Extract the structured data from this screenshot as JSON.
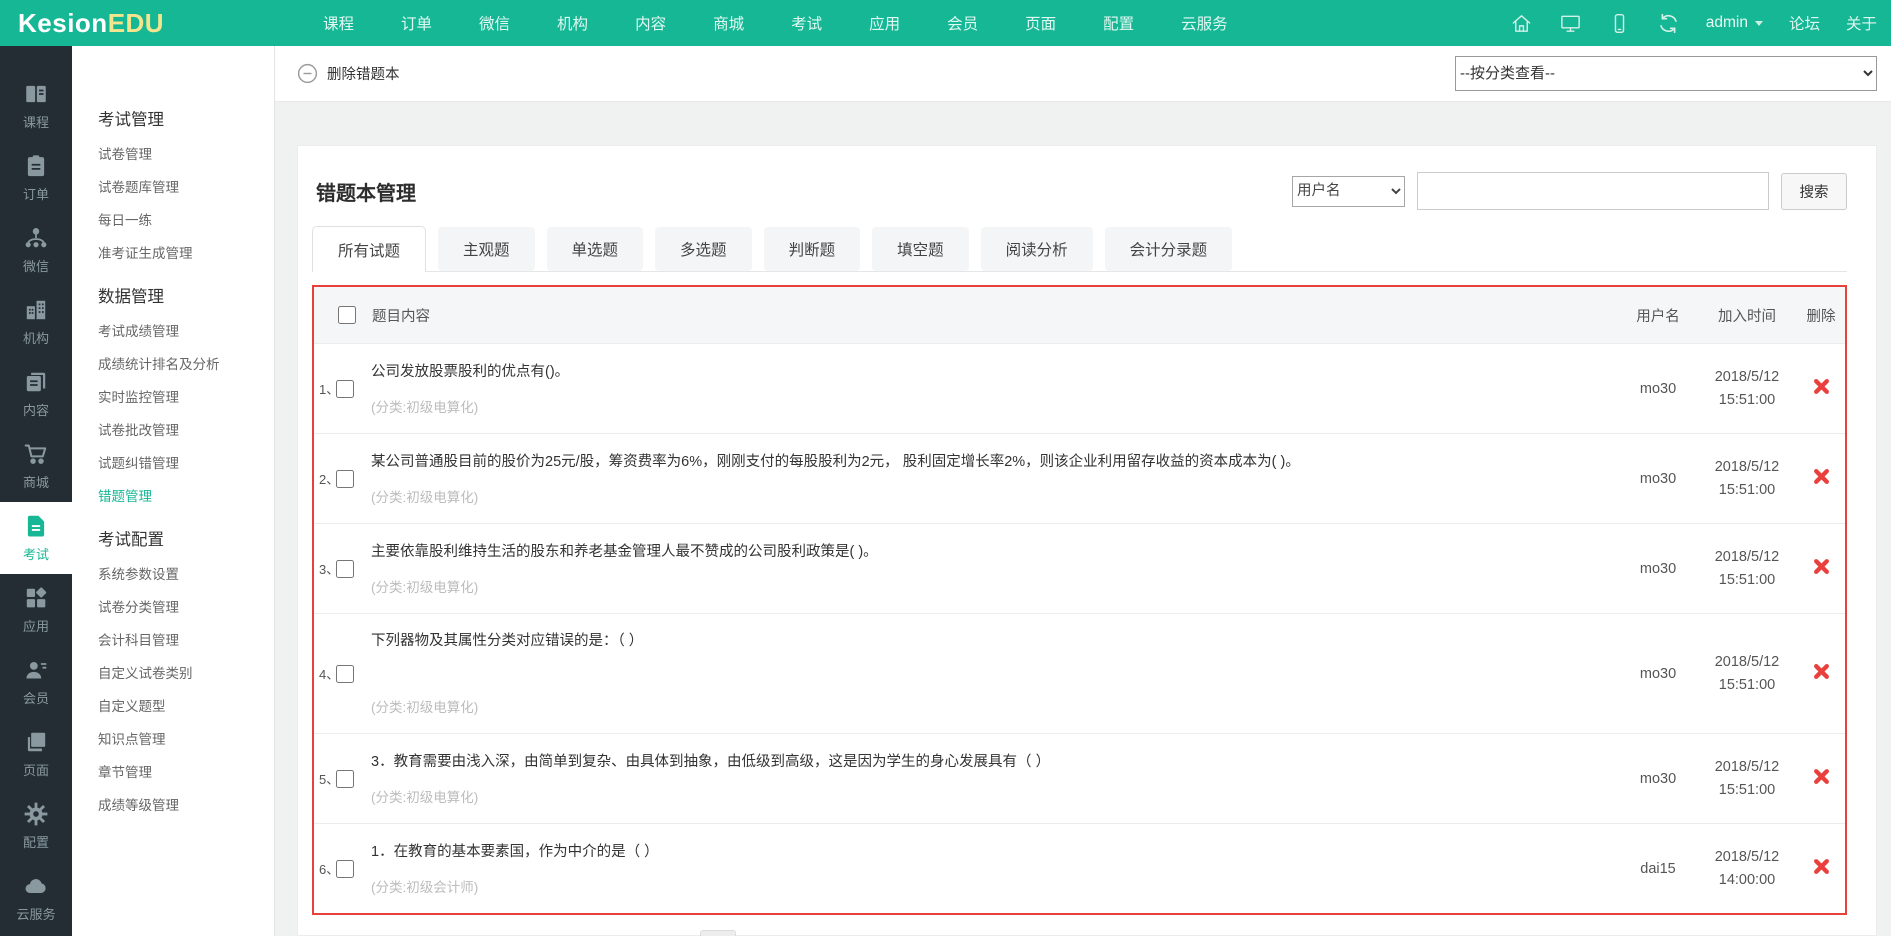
{
  "brand": {
    "name_a": "Kesion",
    "name_b": "EDU"
  },
  "topnav": {
    "items": [
      "课程",
      "订单",
      "微信",
      "机构",
      "内容",
      "商城",
      "考试",
      "应用",
      "会员",
      "页面",
      "配置",
      "云服务"
    ],
    "user": "admin",
    "forum_label": "论坛",
    "about_label": "关于"
  },
  "sidebar": {
    "items": [
      {
        "label": "课程",
        "icon": "courses-icon"
      },
      {
        "label": "订单",
        "icon": "orders-icon"
      },
      {
        "label": "微信",
        "icon": "wechat-icon"
      },
      {
        "label": "机构",
        "icon": "org-icon"
      },
      {
        "label": "内容",
        "icon": "content-icon"
      },
      {
        "label": "商城",
        "icon": "mall-icon"
      },
      {
        "label": "考试",
        "icon": "exam-icon",
        "active": true
      },
      {
        "label": "应用",
        "icon": "apps-icon"
      },
      {
        "label": "会员",
        "icon": "member-icon"
      },
      {
        "label": "页面",
        "icon": "pages-icon"
      },
      {
        "label": "配置",
        "icon": "config-icon"
      },
      {
        "label": "云服务",
        "icon": "cloud-icon"
      }
    ]
  },
  "submenu": {
    "entries": [
      {
        "cls": "title",
        "label": "考试管理"
      },
      {
        "label": "试卷管理"
      },
      {
        "label": "试卷题库管理"
      },
      {
        "label": "每日一练"
      },
      {
        "label": "准考证生成管理"
      },
      {
        "cls": "title",
        "label": "数据管理"
      },
      {
        "label": "考试成绩管理"
      },
      {
        "label": "成绩统计排名及分析"
      },
      {
        "label": "实时监控管理"
      },
      {
        "label": "试卷批改管理"
      },
      {
        "label": "试题纠错管理"
      },
      {
        "label": "错题管理",
        "active": true
      },
      {
        "cls": "title",
        "label": "考试配置"
      },
      {
        "label": "系统参数设置"
      },
      {
        "label": "试卷分类管理"
      },
      {
        "label": "会计科目管理"
      },
      {
        "label": "自定义试卷类别"
      },
      {
        "label": "自定义题型"
      },
      {
        "label": "知识点管理"
      },
      {
        "label": "章节管理"
      },
      {
        "label": "成绩等级管理"
      }
    ]
  },
  "toolbar": {
    "delete_label": "删除错题本",
    "category_filter": "--按分类查看--"
  },
  "main": {
    "title": "错题本管理",
    "search": {
      "field": "用户名",
      "value": "",
      "button": "搜索"
    },
    "tabs": [
      {
        "label": "所有试题",
        "active": true
      },
      {
        "label": "主观题"
      },
      {
        "label": "单选题"
      },
      {
        "label": "多选题"
      },
      {
        "label": "判断题"
      },
      {
        "label": "填空题"
      },
      {
        "label": "阅读分析"
      },
      {
        "label": "会计分录题"
      }
    ],
    "table": {
      "headers": {
        "content": "题目内容",
        "user": "用户名",
        "time": "加入时间",
        "del": "删除"
      },
      "rows": [
        {
          "no": "1、",
          "question": "公司发放股票股利的优点有()。",
          "category": "(分类:初级电算化)",
          "user": "mo30",
          "date": "2018/5/12",
          "time": "15:51:00"
        },
        {
          "no": "2、",
          "question": "某公司普通股目前的股价为25元/股，筹资费率为6%，刚刚支付的每股股利为2元， 股利固定增长率2%，则该企业利用留存收益的资本成本为(  )。",
          "category": "(分类:初级电算化)",
          "user": "mo30",
          "date": "2018/5/12",
          "time": "15:51:00"
        },
        {
          "no": "3、",
          "question": "主要依靠股利维持生活的股东和养老基金管理人最不赞成的公司股利政策是(  )。",
          "category": "(分类:初级电算化)",
          "user": "mo30",
          "date": "2018/5/12",
          "time": "15:51:00"
        },
        {
          "no": "4、",
          "question": "下列器物及其属性分类对应错误的是：（  ）",
          "category": "(分类:初级电算化)",
          "user": "mo30",
          "date": "2018/5/12",
          "time": "15:51:00",
          "tall": true
        },
        {
          "no": "5、",
          "question": "3．教育需要由浅入深，由简单到复杂、由具体到抽象，由低级到高级，这是因为学生的身心发展具有（  ）",
          "category": "(分类:初级电算化)",
          "user": "mo30",
          "date": "2018/5/12",
          "time": "15:51:00"
        },
        {
          "no": "6、",
          "question": "1．在教育的基本要素国，作为中介的是（  ）",
          "category": "(分类:初级会计师)",
          "user": "dai15",
          "date": "2018/5/12",
          "time": "14:00:00"
        }
      ]
    }
  },
  "colors": {
    "accent": "#17b795",
    "danger": "#e9403d",
    "sidebar_bg": "#232d33",
    "logo_accent": "#f3e58d"
  }
}
